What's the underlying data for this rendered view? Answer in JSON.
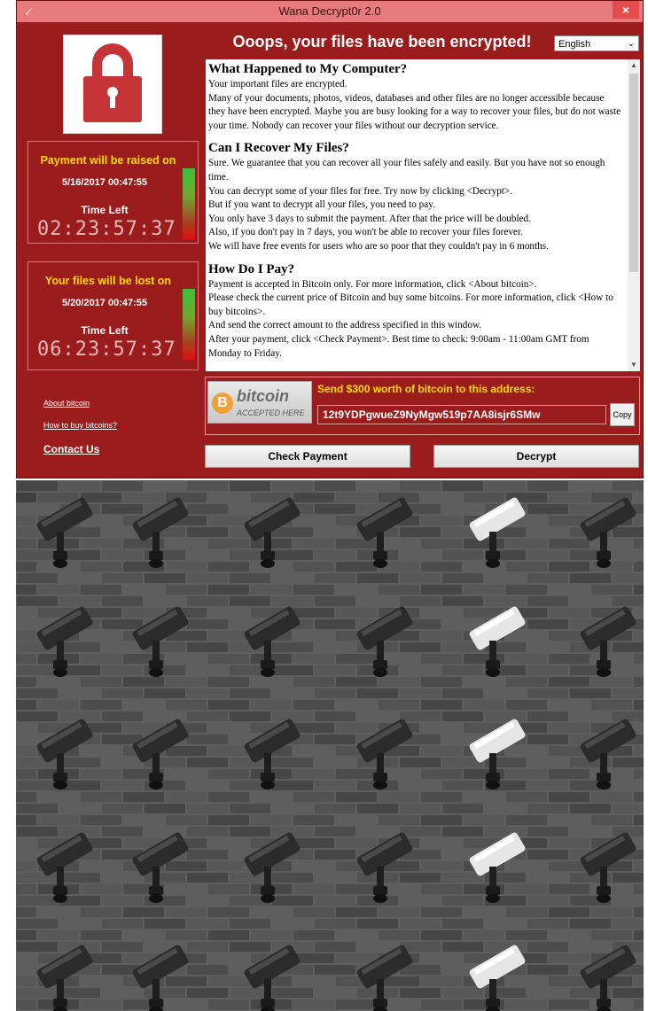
{
  "window": {
    "title": "Wana Decrypt0r 2.0",
    "close_label": "×",
    "headline": "Ooops, your files have been encrypted!",
    "language": "English",
    "accent_color": "#9b1c1c",
    "titlebar_color": "#e77a7c"
  },
  "timers": [
    {
      "heading": "Payment will be raised on",
      "date": "5/16/2017 00:47:55",
      "label": "Time Left",
      "countdown": "02:23:57:37"
    },
    {
      "heading": "Your files will be lost on",
      "date": "5/20/2017 00:47:55",
      "label": "Time Left",
      "countdown": "06:23:57:37"
    }
  ],
  "links": {
    "about": "About bitcoin",
    "howto": "How to buy bitcoins?",
    "contact": "Contact Us"
  },
  "sections": [
    {
      "heading": "What Happened to My Computer?",
      "paragraphs": [
        "Your important files are encrypted.",
        "Many of your documents, photos, videos, databases and other files are no longer accessible because they have been encrypted. Maybe you are busy looking for a way to recover your files, but do not waste your time. Nobody can recover your files without our decryption service."
      ]
    },
    {
      "heading": "Can I Recover My Files?",
      "paragraphs": [
        "Sure. We guarantee that you can recover all your files safely and easily. But you have not so enough time.",
        "You can decrypt some of your files for free. Try now by clicking <Decrypt>.",
        "But if you want to decrypt all your files, you need to pay.",
        "You only have 3 days to submit the payment. After that the price will be doubled.",
        "Also, if you don't pay in 7 days, you won't be able to recover your files forever.",
        "We will have free events for users who are so poor that they couldn't pay in 6 months."
      ]
    },
    {
      "heading": "How Do I Pay?",
      "paragraphs": [
        "Payment is accepted in Bitcoin only. For more information, click <About bitcoin>.",
        "Please check the current price of Bitcoin and buy some bitcoins. For more information, click <How to buy bitcoins>.",
        "And send the correct amount to the address specified in this window.",
        "After your payment, click <Check Payment>. Best time to check: 9:00am - 11:00am GMT from Monday to Friday."
      ]
    }
  ],
  "bitcoin": {
    "logo_word": "bitcoin",
    "logo_sub": "ACCEPTED HERE",
    "send_label": "Send $300 worth of bitcoin to this address:",
    "address": "12t9YDPgwueZ9NyMgw519p7AA8isjr6SMw",
    "copy_label": "Copy"
  },
  "buttons": {
    "check": "Check Payment",
    "decrypt": "Decrypt"
  }
}
